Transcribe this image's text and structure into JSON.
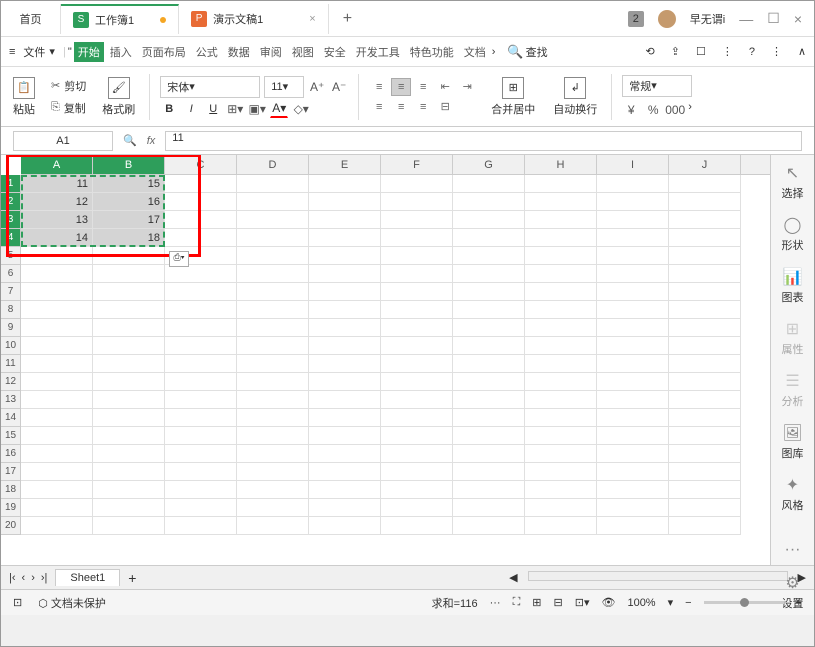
{
  "title": {
    "home": "首页",
    "tab1": "工作簿1",
    "tab2": "演示文稿1",
    "user": "早无谓i",
    "badge": "2"
  },
  "menu": {
    "file": "文件",
    "tabs": [
      "开始",
      "插入",
      "页面布局",
      "公式",
      "数据",
      "审阅",
      "视图",
      "安全",
      "开发工具",
      "特色功能",
      "文档"
    ],
    "search": "查找"
  },
  "ribbon": {
    "cut": "剪切",
    "copy": "复制",
    "paste": "粘贴",
    "format_painter": "格式刷",
    "font": "宋体",
    "size": "11",
    "merge": "合并居中",
    "wrap": "自动换行",
    "numfmt": "常规",
    "currency": "¥",
    "percent": "%",
    "thousand": "000"
  },
  "formula": {
    "cell": "A1",
    "value": "11"
  },
  "cols": [
    "A",
    "B",
    "C",
    "D",
    "E",
    "F",
    "G",
    "H",
    "I",
    "J"
  ],
  "cells": {
    "r1": {
      "A": "11",
      "B": "15"
    },
    "r2": {
      "A": "12",
      "B": "16"
    },
    "r3": {
      "A": "13",
      "B": "17"
    },
    "r4": {
      "A": "14",
      "B": "18"
    }
  },
  "side": {
    "select": "选择",
    "shape": "形状",
    "chart": "图表",
    "prop": "属性",
    "analyze": "分析",
    "gallery": "图库",
    "style": "风格",
    "settings": "设置"
  },
  "sheettab": "Sheet1",
  "status": {
    "protect": "文档未保护",
    "sum": "求和=116",
    "more": "···",
    "zoom": "100%"
  }
}
